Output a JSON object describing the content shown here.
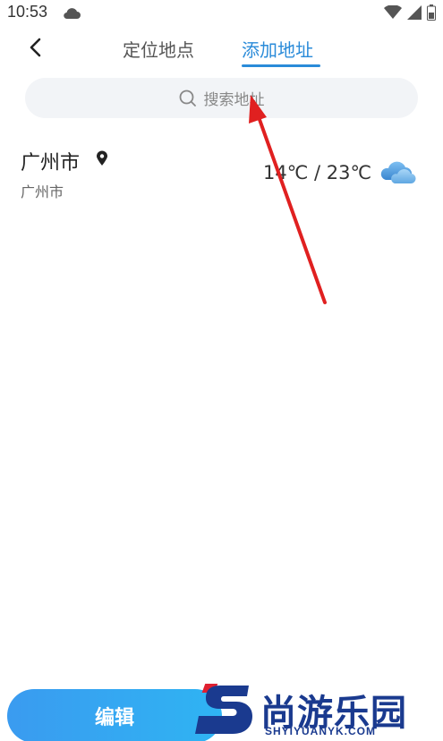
{
  "status_bar": {
    "time": "10:53",
    "icons": [
      "cloud-icon",
      "wifi-icon",
      "signal-icon",
      "battery-icon"
    ]
  },
  "nav": {
    "back_icon": "chevron-left-icon",
    "tabs": [
      {
        "label": "定位地点",
        "active": false
      },
      {
        "label": "添加地址",
        "active": true
      }
    ]
  },
  "search": {
    "placeholder": "搜索地址"
  },
  "cities": [
    {
      "name": "广州市",
      "subtitle": "广州市",
      "temperature": "14℃ / 23℃",
      "weather_icon": "cloudy-icon",
      "is_current_location": true
    }
  ],
  "footer": {
    "edit_label": "编辑"
  },
  "watermark": {
    "text": "尚游乐园",
    "sub": "SHYIYUANYK.COM"
  },
  "colors": {
    "accent": "#2a8bd9",
    "button_gradient_start": "#3a9bf0",
    "button_gradient_end": "#2fb4f3",
    "annotation_arrow": "#e02020",
    "search_bg": "#f2f4f7"
  }
}
